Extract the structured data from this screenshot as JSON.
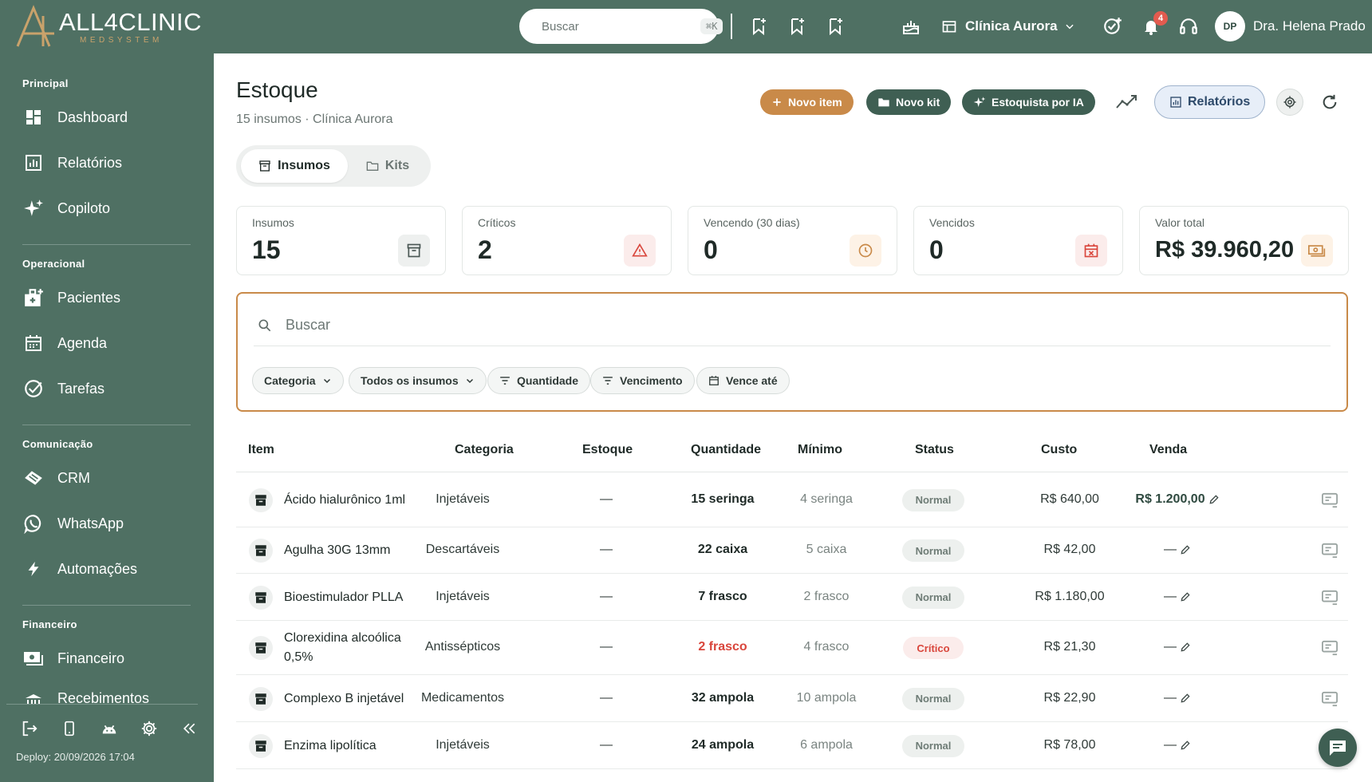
{
  "brand": {
    "name": "ALL4CLINIC",
    "sub": "MEDSYSTEM",
    "accent": "#c98a49",
    "green": "#4f7063"
  },
  "topbar": {
    "search_placeholder": "Buscar",
    "search_shortcut": "⌘K",
    "clinic": "Clínica Aurora",
    "notifications_count": "4",
    "user_initials": "DP",
    "user_name": "Dra. Helena Prado"
  },
  "sidebar": {
    "sections": {
      "principal": "Principal",
      "operacional": "Operacional",
      "comunicacao": "Comunicação",
      "financeiro": "Financeiro"
    },
    "items": {
      "dashboard": "Dashboard",
      "relatorios": "Relatórios",
      "copiloto": "Copiloto",
      "pacientes": "Pacientes",
      "agenda": "Agenda",
      "tarefas": "Tarefas",
      "crm": "CRM",
      "whatsapp": "WhatsApp",
      "automacoes": "Automações",
      "financeiro": "Financeiro",
      "recebimentos": "Recebimentos"
    },
    "deploy": "Deploy: 20/09/2026 17:04"
  },
  "page": {
    "title": "Estoque",
    "subtitle": "15 insumos · Clínica Aurora",
    "buttons": {
      "novo_item": "Novo item",
      "novo_kit": "Novo kit",
      "estoquista": "Estoquista por IA",
      "relatorios": "Relatórios"
    },
    "tabs": {
      "insumos": "Insumos",
      "kits": "Kits"
    }
  },
  "stats": {
    "insumos": {
      "label": "Insumos",
      "value": "15"
    },
    "criticos": {
      "label": "Críticos",
      "value": "2"
    },
    "vencendo": {
      "label": "Vencendo (30 dias)",
      "value": "0"
    },
    "vencidos": {
      "label": "Vencidos",
      "value": "0"
    },
    "valor": {
      "label": "Valor total",
      "value": "R$ 39.960,20"
    }
  },
  "filters": {
    "search_placeholder": "Buscar",
    "categoria": "Categoria",
    "todos": "Todos os insumos",
    "quantidade": "Quantidade",
    "vencimento": "Vencimento",
    "vence_ate": "Vence até"
  },
  "table": {
    "headers": {
      "item": "Item",
      "categoria": "Categoria",
      "estoque": "Estoque",
      "quantidade": "Quantidade",
      "minimo": "Mínimo",
      "status": "Status",
      "custo": "Custo",
      "venda": "Venda"
    },
    "rows": [
      {
        "name": "Ácido hialurônico 1ml",
        "categoria": "Injetáveis",
        "estoque": "—",
        "quantidade": "15 seringa",
        "minimo": "4 seringa",
        "status": "Normal",
        "custo": "R$ 640,00",
        "venda": "R$ 1.200,00"
      },
      {
        "name": "Agulha 30G 13mm",
        "categoria": "Descartáveis",
        "estoque": "—",
        "quantidade": "22 caixa",
        "minimo": "5 caixa",
        "status": "Normal",
        "custo": "R$ 42,00",
        "venda": "—"
      },
      {
        "name": "Bioestimulador PLLA",
        "categoria": "Injetáveis",
        "estoque": "—",
        "quantidade": "7 frasco",
        "minimo": "2 frasco",
        "status": "Normal",
        "custo": "R$ 1.180,00",
        "venda": "—"
      },
      {
        "name": "Clorexidina alcoólica 0,5%",
        "categoria": "Antissépticos",
        "estoque": "—",
        "quantidade": "2 frasco",
        "minimo": "4 frasco",
        "status": "Crítico",
        "custo": "R$ 21,30",
        "venda": "—"
      },
      {
        "name": "Complexo B injetável",
        "categoria": "Medicamentos",
        "estoque": "—",
        "quantidade": "32 ampola",
        "minimo": "10 ampola",
        "status": "Normal",
        "custo": "R$ 22,90",
        "venda": "—"
      },
      {
        "name": "Enzima lipolítica",
        "categoria": "Injetáveis",
        "estoque": "—",
        "quantidade": "24 ampola",
        "minimo": "6 ampola",
        "status": "Normal",
        "custo": "R$ 78,00",
        "venda": "—"
      }
    ]
  }
}
